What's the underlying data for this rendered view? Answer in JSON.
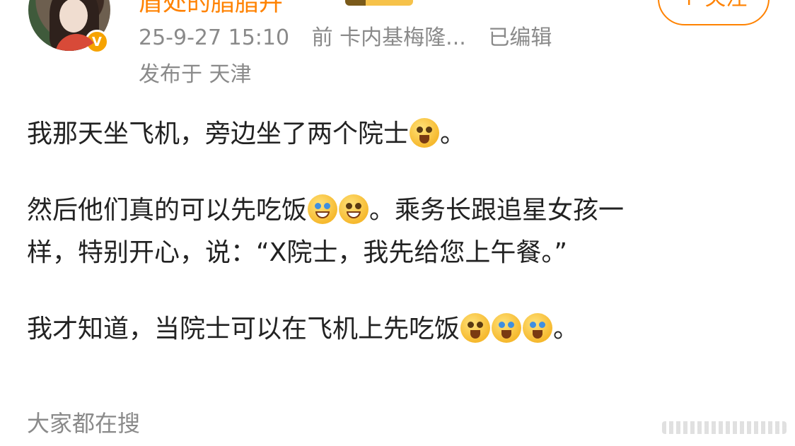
{
  "header": {
    "username": "盾处的脂脂卉",
    "follow_label": "+ 关注",
    "verified_badge": "V",
    "timestamp": "25-9-27 15:10",
    "source": "前 卡内基梅隆...",
    "edited": "已编辑",
    "location": "发布于 天津",
    "icons": [
      "avatar",
      "verified-badge-icon",
      "level-badge-icon"
    ]
  },
  "post": {
    "p1_text": "我那天坐飞机，旁边坐了两个院士",
    "p1_end": "。",
    "p2_line1_a": "然后他们真的可以先吃饭",
    "p2_line1_b": "。乘务长跟追星女孩一",
    "p2_line2": "样，特别开心，说：“X院士，我先给您上午餐。”",
    "p3_text": "我才知道，当院士可以在飞机上先吃饭",
    "p3_end": "。",
    "emojis": [
      "shocked-emoji-icon",
      "laugh-cry-emoji-icon",
      "laugh-emoji-icon",
      "shocked-emoji-icon",
      "crying-emoji-icon",
      "crying-emoji-icon"
    ]
  },
  "footer": {
    "search_label": "大家都在搜"
  },
  "colors": {
    "accent": "#ff8200",
    "meta_text": "#8a8a8a",
    "body_text": "#222222"
  }
}
